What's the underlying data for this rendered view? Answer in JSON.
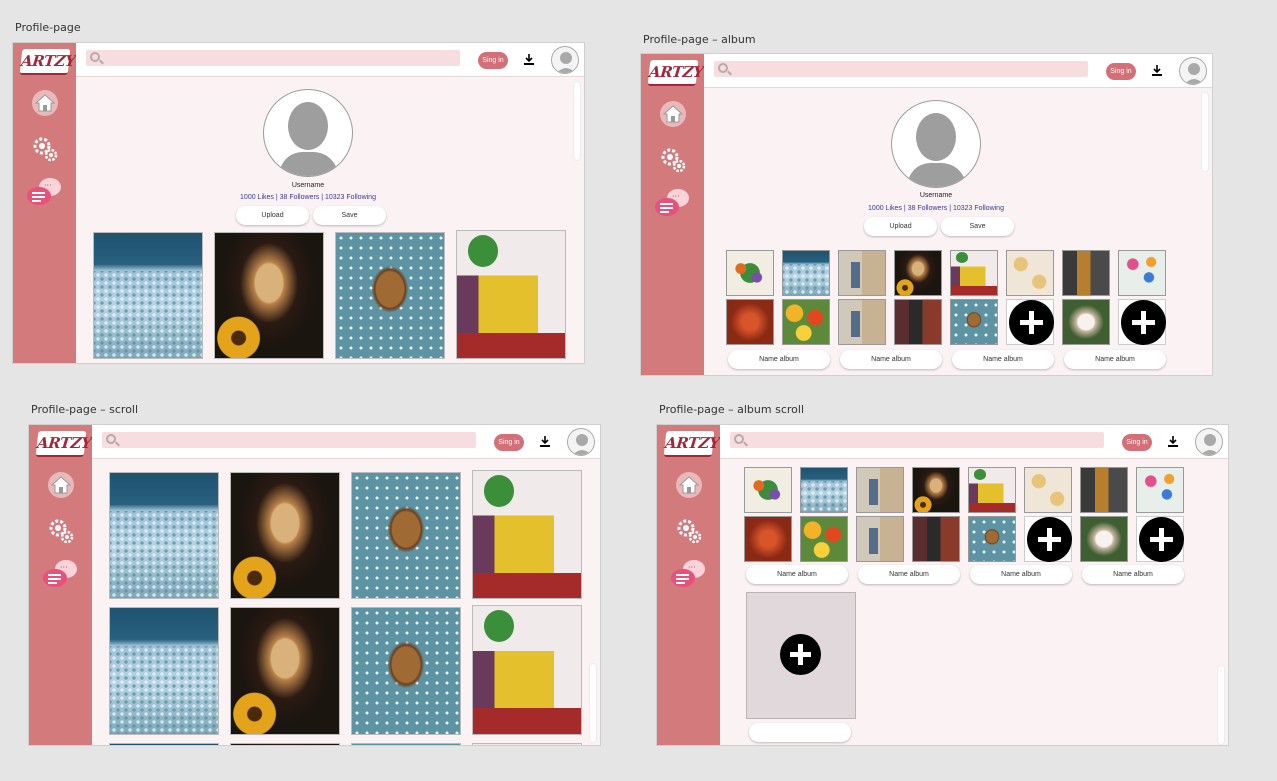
{
  "frames": {
    "f1": {
      "label": "Profile-page"
    },
    "f2": {
      "label": "Profile-page – album"
    },
    "f3": {
      "label": "Profile-page – scroll"
    },
    "f4": {
      "label": "Profile-page – album  scroll"
    }
  },
  "app": {
    "logo": "ARTZY",
    "signin_label": "Sing in",
    "accent": "#d27a7c",
    "button_color": "#d36f77",
    "content_bg": "#fbf2f4"
  },
  "profile": {
    "username": "Username",
    "stats": "1000 Likes |  38 Followers | 10323 Following",
    "upload_label": "Upload",
    "save_label": "Save"
  },
  "albums": {
    "name_label": "Name album"
  },
  "icons": {
    "sidebar": [
      "home-icon",
      "gear-icon",
      "chat-icon"
    ],
    "topbar": [
      "search-icon",
      "download-icon",
      "avatar-icon"
    ]
  }
}
